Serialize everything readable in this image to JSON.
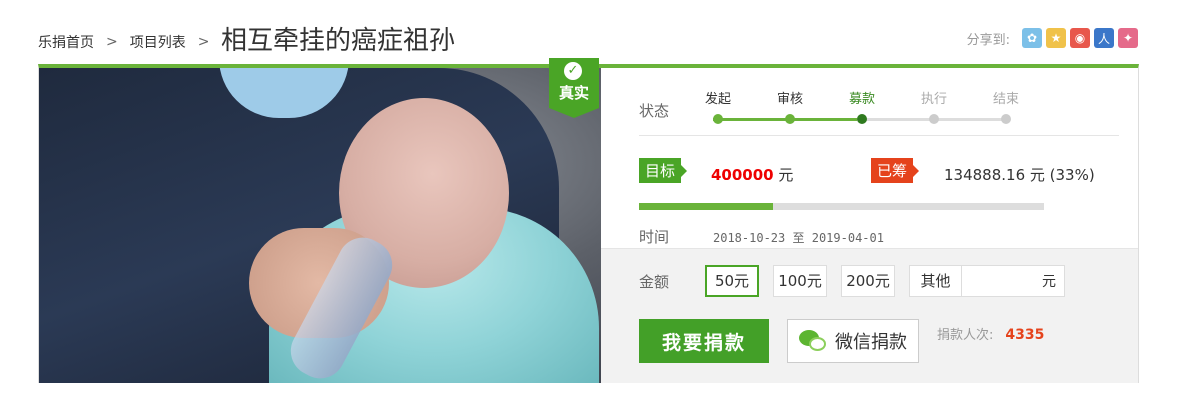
{
  "breadcrumb": {
    "home": "乐捐首页",
    "list": "项目列表",
    "separator": ">"
  },
  "title": "相互牵挂的癌症祖孙",
  "share": {
    "label": "分享到:",
    "icons": [
      {
        "name": "qzone-icon",
        "color": "#7cc0e8",
        "glyph": "✿"
      },
      {
        "name": "favorite-icon",
        "color": "#f0c24a",
        "glyph": "★"
      },
      {
        "name": "weibo-icon",
        "color": "#e8574c",
        "glyph": "◉"
      },
      {
        "name": "renren-icon",
        "color": "#3b77c9",
        "glyph": "人"
      },
      {
        "name": "kaixin-icon",
        "color": "#e56a8a",
        "glyph": "✦"
      }
    ]
  },
  "badge": {
    "text": "真实"
  },
  "status": {
    "label": "状态",
    "steps": [
      {
        "label": "发起",
        "state": "done"
      },
      {
        "label": "审核",
        "state": "done"
      },
      {
        "label": "募款",
        "state": "current"
      },
      {
        "label": "执行",
        "state": "todo"
      },
      {
        "label": "结束",
        "state": "todo"
      }
    ]
  },
  "goal": {
    "tag": "目标",
    "value": "400000",
    "unit": "元"
  },
  "raised": {
    "tag": "已筹",
    "value": "134888.16 元 (33%)",
    "percent": 33
  },
  "time": {
    "label": "时间",
    "start": "2018-10-23",
    "sep": "至",
    "end": "2019-04-01"
  },
  "amount": {
    "label": "金额",
    "options": [
      "50元",
      "100元",
      "200元"
    ],
    "selected_index": 0,
    "other_label": "其他",
    "other_value": "",
    "other_unit": "元"
  },
  "actions": {
    "donate": "我要捐款",
    "wechat": "微信捐款"
  },
  "donors": {
    "label": "捐款人次:",
    "count": "4335"
  },
  "colors": {
    "accent": "#4aa526",
    "raised": "#e5431c",
    "goal_value": "#ee0000"
  }
}
